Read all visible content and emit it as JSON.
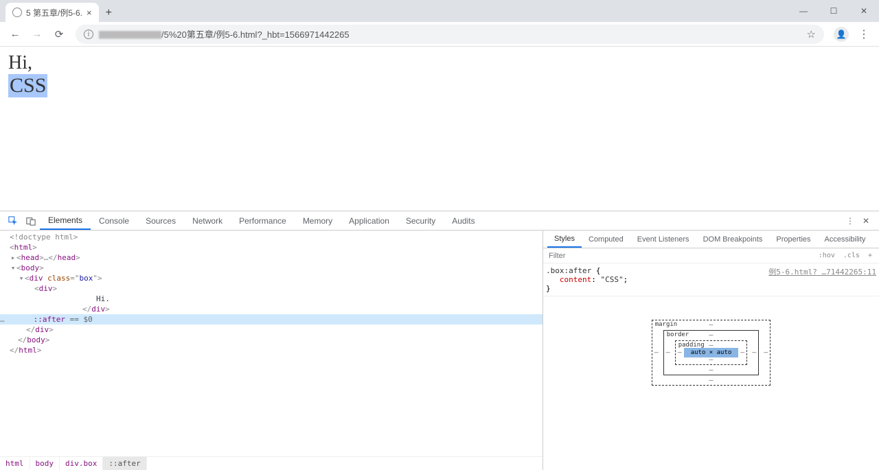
{
  "window": {
    "tab_title": "5 第五章/例5-6.",
    "url_visible": "/5%20第五章/例5-6.html?_hbt=1566971442265"
  },
  "page": {
    "line1": "Hi,",
    "line2": "CSS"
  },
  "devtools": {
    "tabs": [
      "Elements",
      "Console",
      "Sources",
      "Network",
      "Performance",
      "Memory",
      "Application",
      "Security",
      "Audits"
    ],
    "tree": {
      "doctype": "<!doctype html>",
      "html_open": "html",
      "head": "head",
      "body": "body",
      "div_class": "box",
      "inner_div": "div",
      "text_hi": "Hi.",
      "after": "::after",
      "eq": "== $0"
    },
    "breadcrumb": [
      "html",
      "body",
      "div.box",
      "::after"
    ]
  },
  "sidebar": {
    "tabs": [
      "Styles",
      "Computed",
      "Event Listeners",
      "DOM Breakpoints",
      "Properties",
      "Accessibility"
    ],
    "filter_placeholder": "Filter",
    "ctrl_hov": ":hov",
    "ctrl_cls": ".cls",
    "ctrl_plus": "+",
    "rule": {
      "selector": ".box:after",
      "prop": "content",
      "val": "\"CSS\"",
      "link": "例5-6.html? …71442265:11"
    },
    "box_model": {
      "margin": "margin",
      "border": "border",
      "padding": "padding",
      "content": "auto × auto",
      "dash": "–"
    }
  }
}
